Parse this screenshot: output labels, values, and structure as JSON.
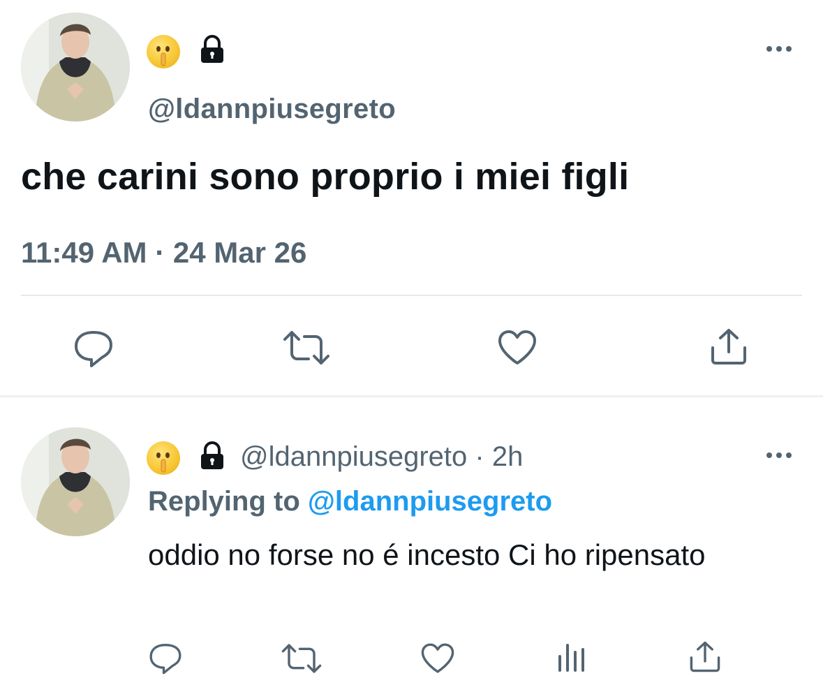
{
  "main_tweet": {
    "handle": "@ldannpiusegreto",
    "text": "che carini sono proprio i miei figli",
    "time": "11:49 AM",
    "separator": "·",
    "date": "24 Mar 26",
    "actions": [
      "reply-icon",
      "retweet-icon",
      "like-icon",
      "share-icon"
    ]
  },
  "reply_tweet": {
    "handle": "@ldannpiusegreto",
    "separator": "·",
    "age": "2h",
    "replying_prefix": "Replying to",
    "replying_to": "@ldannpiusegreto",
    "text": "oddio no forse no é incesto Ci ho ripensato",
    "actions": [
      "reply-icon",
      "retweet-icon",
      "like-icon",
      "analytics-icon",
      "share-icon"
    ]
  },
  "colors": {
    "text_primary": "#0f1419",
    "text_secondary": "#536471",
    "link": "#1d9bf0",
    "divider": "#e6e9ec"
  }
}
